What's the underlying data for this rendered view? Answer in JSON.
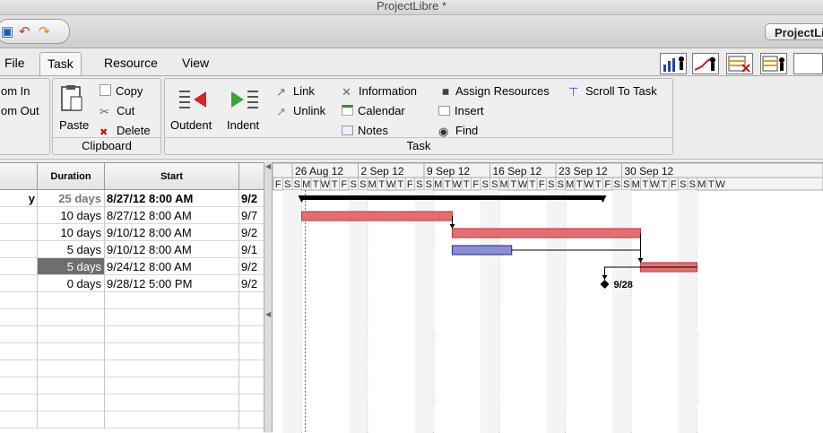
{
  "window": {
    "title": "ProjectLibre *"
  },
  "toolbar": {
    "project_button": "ProjectLi"
  },
  "tabs": [
    "File",
    "Task",
    "Resource",
    "View"
  ],
  "ribbon": {
    "zoom": {
      "zoom_in": "om In",
      "zoom_out": "om Out"
    },
    "clipboard": {
      "paste": "Paste",
      "copy": "Copy",
      "cut": "Cut",
      "delete": "Delete",
      "caption": "Clipboard"
    },
    "task": {
      "outdent": "Outdent",
      "indent": "Indent",
      "link": "Link",
      "unlink": "Unlink",
      "information": "Information",
      "calendar": "Calendar",
      "notes": "Notes",
      "assign_resources": "Assign Resources",
      "insert": "Insert",
      "find": "Find",
      "scroll_to_task": "Scroll To Task",
      "caption": "Task"
    }
  },
  "table": {
    "headers": {
      "duration": "Duration",
      "start": "Start"
    },
    "rows": [
      {
        "name": "y",
        "duration": "25 days",
        "start": "8/27/12 8:00 AM",
        "finish": "9/2",
        "summary": true
      },
      {
        "name": "",
        "duration": "10 days",
        "start": "8/27/12 8:00 AM",
        "finish": "9/7",
        "summary": false
      },
      {
        "name": "",
        "duration": "10 days",
        "start": "9/10/12 8:00 AM",
        "finish": "9/2",
        "summary": false
      },
      {
        "name": "",
        "duration": "5 days",
        "start": "9/10/12 8:00 AM",
        "finish": "9/1",
        "summary": false
      },
      {
        "name": "",
        "duration": "5 days",
        "start": "9/24/12 8:00 AM",
        "finish": "9/2",
        "summary": false,
        "selected": true
      },
      {
        "name": "",
        "duration": "0 days",
        "start": "9/28/12 5:00 PM",
        "finish": "9/2",
        "summary": false
      }
    ]
  },
  "gantt": {
    "weeks": [
      "26 Aug 12",
      "2 Sep 12",
      "9 Sep 12",
      "16 Sep 12",
      "23 Sep 12",
      "30 Sep 12"
    ],
    "days": [
      "F",
      "S",
      "S",
      "M",
      "T",
      "W",
      "T",
      "F",
      "S",
      "S",
      "M",
      "T",
      "W",
      "T",
      "F",
      "S",
      "S",
      "M",
      "T",
      "W",
      "T",
      "F",
      "S",
      "S",
      "M",
      "T",
      "W",
      "T",
      "F",
      "S",
      "S",
      "M",
      "T",
      "W",
      "T",
      "F",
      "S",
      "S",
      "M",
      "T",
      "W",
      "T",
      "F",
      "S",
      "S",
      "M",
      "T",
      "W"
    ],
    "milestone_label": "9/28",
    "colors": {
      "task_bar": "#c8434b",
      "critical_fill": "#e07070",
      "blue_bar": "#3a3a9a",
      "summary": "#000000"
    }
  }
}
